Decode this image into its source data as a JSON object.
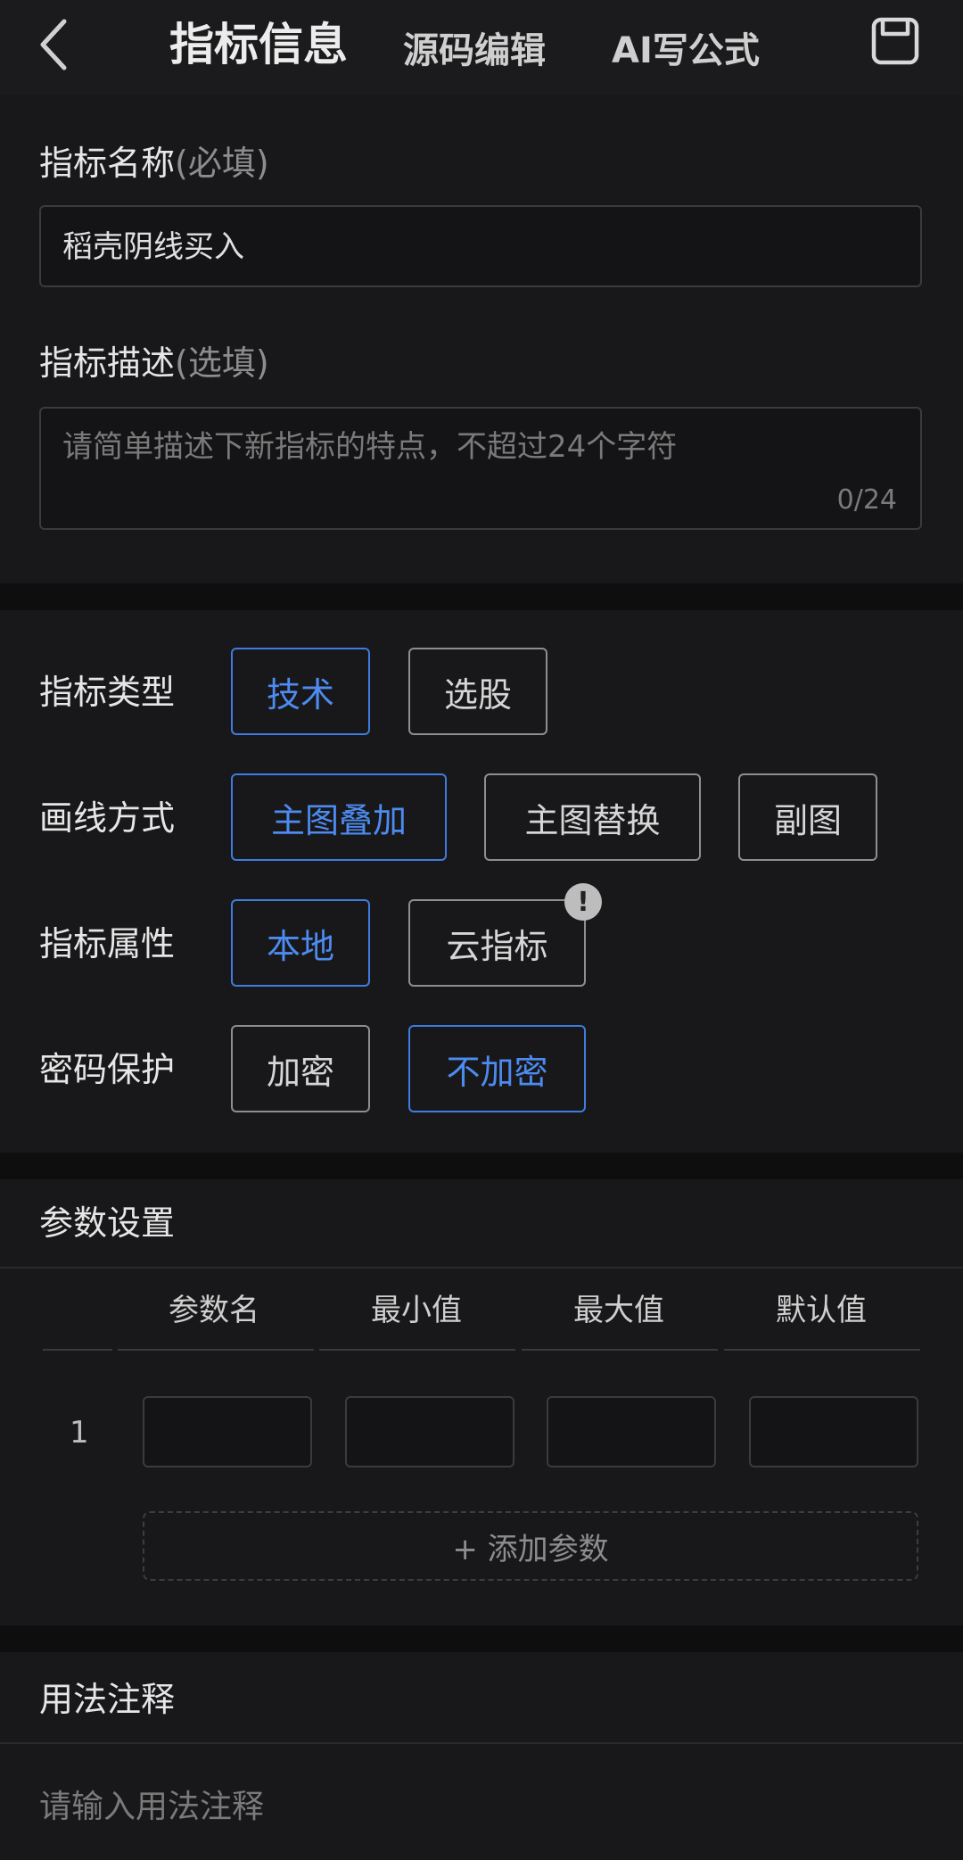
{
  "header": {
    "title": "指标信息",
    "tabs": [
      "源码编辑",
      "AI写公式"
    ]
  },
  "name_field": {
    "label": "指标名称",
    "hint": "(必填)",
    "value": "稻壳阴线买入"
  },
  "desc_field": {
    "label": "指标描述",
    "hint": "(选填)",
    "placeholder": "请简单描述下新指标的特点，不超过24个字符",
    "counter": "0/24"
  },
  "options": {
    "type": {
      "label": "指标类型",
      "choices": [
        "技术",
        "选股"
      ],
      "selected": "技术"
    },
    "draw": {
      "label": "画线方式",
      "choices": [
        "主图叠加",
        "主图替换",
        "副图"
      ],
      "selected": "主图叠加"
    },
    "attr": {
      "label": "指标属性",
      "choices": [
        "本地",
        "云指标"
      ],
      "selected": "本地",
      "warn_badge": "!"
    },
    "password": {
      "label": "密码保护",
      "choices": [
        "加密",
        "不加密"
      ],
      "selected": "不加密"
    }
  },
  "params": {
    "section_title": "参数设置",
    "columns": [
      "参数名",
      "最小值",
      "最大值",
      "默认值"
    ],
    "rows": [
      {
        "index": "1"
      }
    ],
    "add_button": "+ 添加参数"
  },
  "usage": {
    "section_title": "用法注释",
    "placeholder": "请输入用法注释"
  },
  "colors": {
    "accent": "#4d8bf0",
    "background": "#0e0e0f",
    "panel": "#18181a"
  }
}
